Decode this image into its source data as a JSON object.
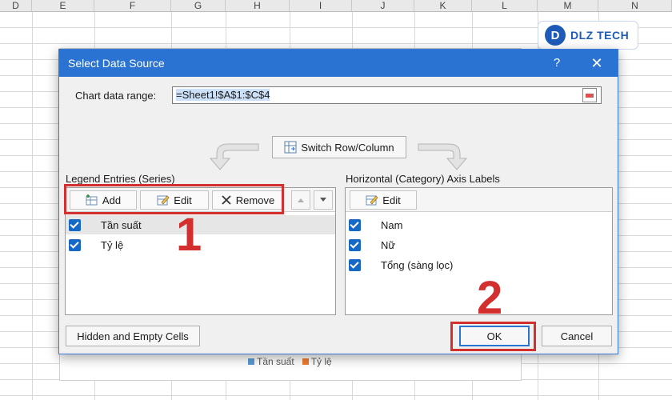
{
  "sheet": {
    "columns": [
      "D",
      "E",
      "F",
      "G",
      "H",
      "I",
      "J",
      "K",
      "L",
      "M",
      "N"
    ]
  },
  "chart": {
    "legend": [
      {
        "name": "Tần suất",
        "color": "#5b9bd5"
      },
      {
        "name": "Tỷ lệ",
        "color": "#ed7d31"
      }
    ]
  },
  "logo": {
    "mark": "D",
    "text": "DLZ TECH"
  },
  "dialog": {
    "title": "Select Data Source",
    "help_label": "?",
    "close_label": "✕",
    "range_label": "Chart data range:",
    "range_value": "=Sheet1!$A$1:$C$4",
    "switch_label": "Switch Row/Column",
    "legend_panel": {
      "label": "Legend Entries (Series)",
      "add_label": "Add",
      "edit_label": "Edit",
      "remove_label": "Remove",
      "items": [
        {
          "label": "Tần suất",
          "checked": true
        },
        {
          "label": "Tỷ lệ",
          "checked": true
        }
      ]
    },
    "axis_panel": {
      "label": "Horizontal (Category) Axis Labels",
      "edit_label": "Edit",
      "items": [
        {
          "label": "Nam",
          "checked": true
        },
        {
          "label": "Nữ",
          "checked": true
        },
        {
          "label": "Tổng (sàng lọc)",
          "checked": true
        }
      ]
    },
    "hidden_cells_label": "Hidden and Empty Cells",
    "ok_label": "OK",
    "cancel_label": "Cancel"
  },
  "annotations": {
    "step1": "1",
    "step2": "2",
    "highlight_color": "#d32f2f"
  }
}
